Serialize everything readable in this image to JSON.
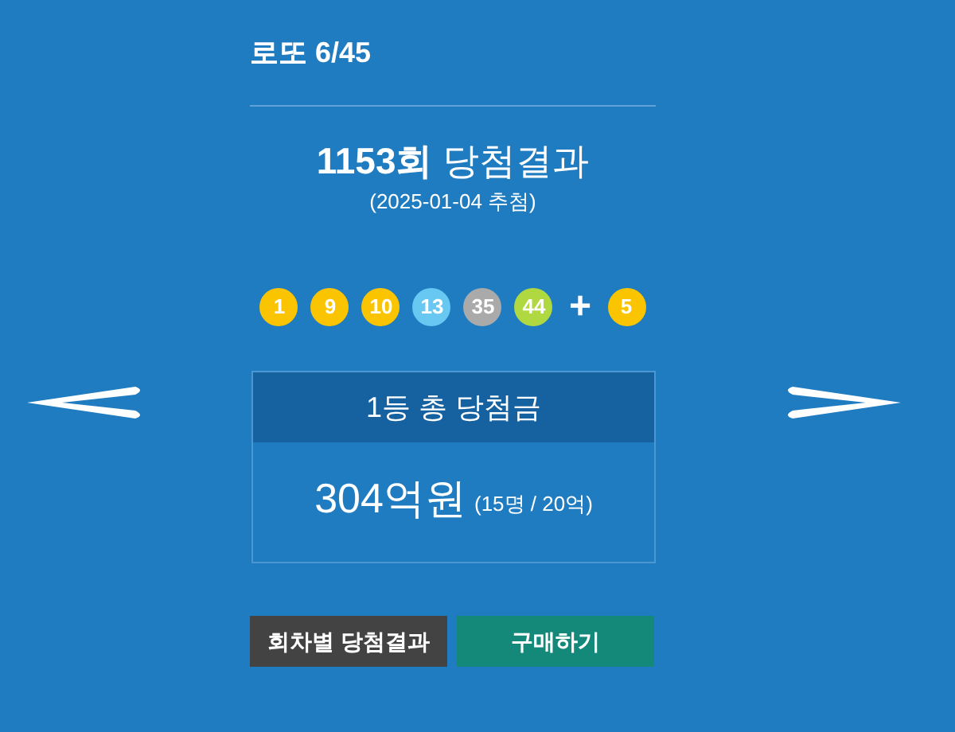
{
  "header": {
    "title": "로또 6/45"
  },
  "draw": {
    "heading": "**1153회** 당첨결과",
    "date": "(2025-01-04 추첨)"
  },
  "balls": [
    {
      "number": "1",
      "color": "#fbc400"
    },
    {
      "number": "9",
      "color": "#fbc400"
    },
    {
      "number": "10",
      "color": "#fbc400"
    },
    {
      "number": "13",
      "color": "#69c8f2"
    },
    {
      "number": "35",
      "color": "#aaaaaa"
    },
    {
      "number": "44",
      "color": "#b0d840"
    }
  ],
  "plus": "+",
  "bonus": {
    "number": "5",
    "color": "#fbc400"
  },
  "prize": {
    "title": "1등 총 당첨금",
    "amount": "304억원",
    "detail": "(15명 / 20억)"
  },
  "buttons": [
    {
      "label": "회차별 당첨결과",
      "kind": "results"
    },
    {
      "label": "구매하기",
      "kind": "buy"
    }
  ]
}
